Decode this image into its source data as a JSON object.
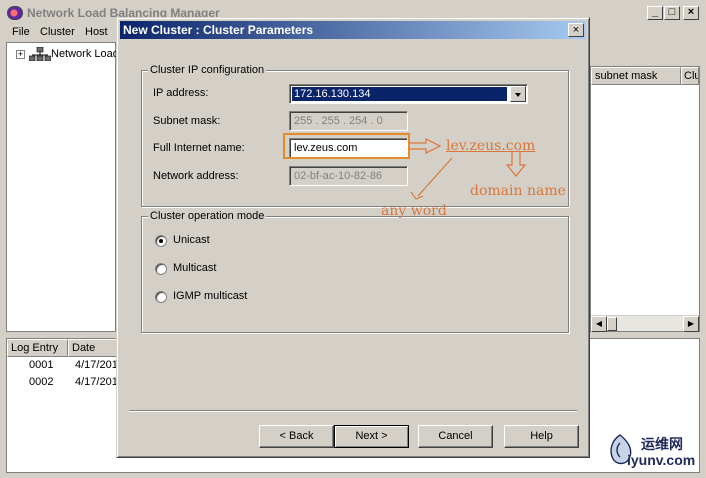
{
  "main_window": {
    "title": "Network Load Balancing Manager",
    "minimize_glyph": "_",
    "maximize_glyph": "□",
    "close_glyph": "×",
    "menu": [
      "File",
      "Cluster",
      "Host"
    ],
    "tree": {
      "expander": "+",
      "root_label": "Network Load"
    },
    "right_columns": [
      "subnet mask",
      "Clu"
    ],
    "scroll_left": "◀",
    "scroll_right": "▶",
    "log_columns": [
      "Log Entry",
      "Date"
    ],
    "log_rows": [
      {
        "entry": "0001",
        "date": "4/17/201"
      },
      {
        "entry": "0002",
        "date": "4/17/201"
      }
    ]
  },
  "dialog": {
    "title": "New Cluster : Cluster Parameters",
    "close_glyph": "×",
    "ip_group": {
      "legend": "Cluster IP configuration",
      "ip_label": "IP address:",
      "ip_value": "172.16.130.134",
      "subnet_label": "Subnet mask:",
      "subnet_value": "255 . 255 . 254 .   0",
      "fqdn_label": "Full Internet name:",
      "fqdn_value": "lev.zeus.com",
      "mac_label": "Network address:",
      "mac_value": "02-bf-ac-10-82-86"
    },
    "mode_group": {
      "legend": "Cluster operation mode",
      "options": [
        {
          "label": "Unicast",
          "checked": true
        },
        {
          "label": "Multicast",
          "checked": false
        },
        {
          "label": "IGMP multicast",
          "checked": false
        }
      ]
    },
    "buttons": {
      "back": "< Back",
      "next": "Next >",
      "cancel": "Cancel",
      "help": "Help"
    }
  },
  "annotations": {
    "hostname": "lev.zeus.com",
    "any_word": "any word",
    "domain_name": "domain name",
    "color": "#d9773a"
  },
  "watermark": {
    "line1": "运维网",
    "line2": "iyunv.com"
  }
}
